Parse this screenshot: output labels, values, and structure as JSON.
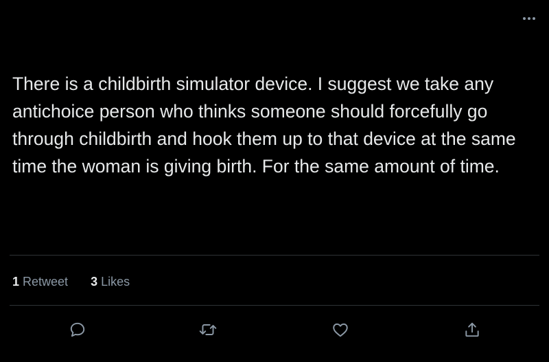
{
  "tweet": {
    "text": "There is a childbirth simulator device. I suggest we take any antichoice person who thinks someone should forcefully go through childbirth and hook them up to that device at the same time the woman is giving birth. For the same amount of time."
  },
  "stats": {
    "retweets_count": "1",
    "retweets_label": "Retweet",
    "likes_count": "3",
    "likes_label": "Likes"
  },
  "actions": {
    "reply_icon": "speech-bubble-icon",
    "retweet_icon": "retweet-arrows-icon",
    "like_icon": "heart-icon",
    "share_icon": "share-upload-icon"
  },
  "colors": {
    "background": "#000000",
    "text": "#e7e9ea",
    "secondary": "#8b98a5",
    "divider": "#2f3336"
  }
}
